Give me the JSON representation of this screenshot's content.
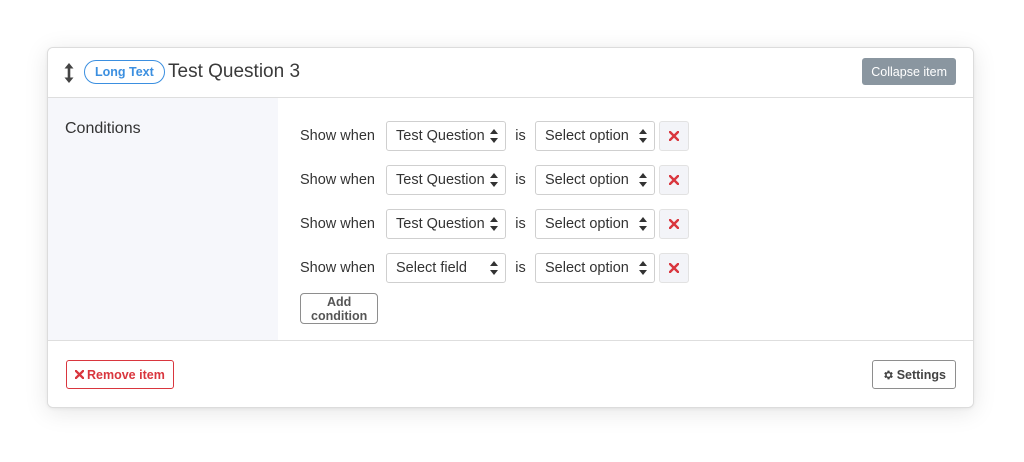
{
  "header": {
    "badge": "Long Text",
    "title": "Test Question 3",
    "collapse_label": "Collapse item",
    "drag_icon": "resize-vertical-icon"
  },
  "sidebar": {
    "label": "Conditions"
  },
  "conditions": {
    "rows": [
      {
        "show_when": "Show when",
        "field": "Test Question",
        "is": "is",
        "option": "Select option"
      },
      {
        "show_when": "Show when",
        "field": "Test Question",
        "is": "is",
        "option": "Select option"
      },
      {
        "show_when": "Show when",
        "field": "Test Question",
        "is": "is",
        "option": "Select option"
      },
      {
        "show_when": "Show when",
        "field": "Select field",
        "is": "is",
        "option": "Select option"
      }
    ],
    "add_label": "Add condition"
  },
  "footer": {
    "remove_label": "Remove item",
    "settings_label": "Settings"
  },
  "colors": {
    "accent_blue": "#3b8fe0",
    "danger_red": "#d9363e",
    "collapse_gray": "#8a96a0",
    "sidebar_bg": "#f6f7fb"
  }
}
